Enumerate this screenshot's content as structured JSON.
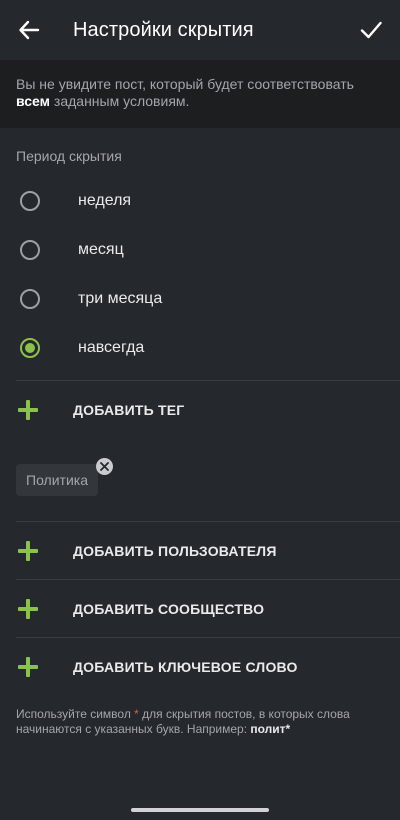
{
  "appbar": {
    "back_icon": "arrow-left-icon",
    "title": "Настройки скрытия",
    "confirm_icon": "check-icon"
  },
  "info": {
    "text_before": "Вы не увидите пост, который будет соответствовать ",
    "text_bold": "всем",
    "text_after": " заданным условиям."
  },
  "period": {
    "title": "Период скрытия",
    "options": [
      {
        "label": "неделя",
        "selected": false
      },
      {
        "label": "месяц",
        "selected": false
      },
      {
        "label": "три месяца",
        "selected": false
      },
      {
        "label": "навсегда",
        "selected": true
      }
    ]
  },
  "actions": {
    "add_tag": "ДОБАВИТЬ ТЕГ",
    "add_user": "ДОБАВИТЬ ПОЛЬЗОВАТЕЛЯ",
    "add_community": "ДОБАВИТЬ СООБЩЕСТВО",
    "add_keyword": "ДОБАВИТЬ КЛЮЧЕВОЕ СЛОВО"
  },
  "tags": [
    {
      "label": "Политика"
    }
  ],
  "hint": {
    "text_before": "Используйте символ ",
    "star": "*",
    "text_middle": " для скрытия постов, в которых слова начинаются с указанных букв. Например: ",
    "example": "полит*"
  },
  "colors": {
    "background": "#25282c",
    "info_background": "#1c1e20",
    "accent": "#8bc34a",
    "asterisk": "#e05a4a"
  }
}
